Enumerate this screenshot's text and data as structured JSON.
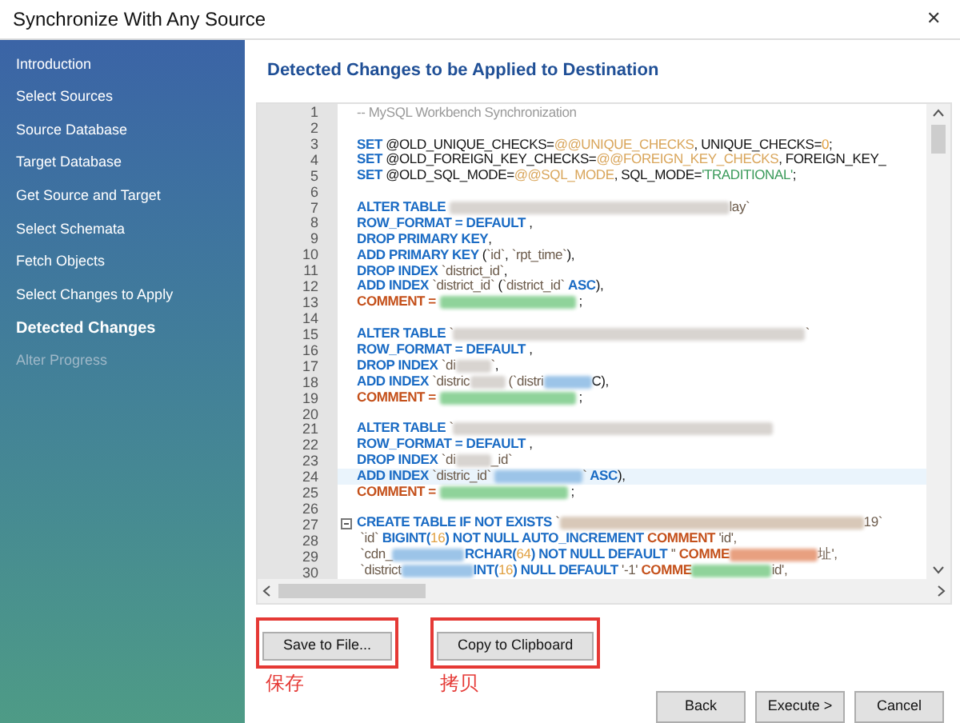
{
  "window": {
    "title": "Synchronize With Any Source",
    "close": "✕"
  },
  "sidebar": {
    "items": [
      {
        "label": "Introduction",
        "selected": false,
        "disabled": false
      },
      {
        "label": "Select Sources",
        "selected": false,
        "disabled": false
      },
      {
        "label": "Source Database",
        "selected": false,
        "disabled": false
      },
      {
        "label": "Target Database",
        "selected": false,
        "disabled": false
      },
      {
        "label": "Get Source and Target",
        "selected": false,
        "disabled": false
      },
      {
        "label": "Select Schemata",
        "selected": false,
        "disabled": false
      },
      {
        "label": "Fetch Objects",
        "selected": false,
        "disabled": false
      },
      {
        "label": "Select Changes to Apply",
        "selected": false,
        "disabled": false
      },
      {
        "label": "Detected Changes",
        "selected": true,
        "disabled": false
      },
      {
        "label": "Alter Progress",
        "selected": false,
        "disabled": true
      }
    ]
  },
  "heading": "Detected Changes to be Applied to Destination",
  "editor": {
    "lines": [
      {
        "n": "1",
        "current": false,
        "fold": false,
        "segs": [
          {
            "kind": "comment",
            "text": "-- MySQL Workbench Synchronization"
          }
        ]
      },
      {
        "n": "2",
        "current": false,
        "fold": false
      },
      {
        "n": "3",
        "current": false,
        "fold": false,
        "segs": [
          {
            "kind": "kw",
            "text": "SET "
          },
          {
            "kind": "plain",
            "text": "@OLD_UNIQUE_CHECKS="
          },
          {
            "kind": "sys",
            "text": "@@UNIQUE_CHECKS"
          },
          {
            "kind": "plain",
            "text": ", UNIQUE_CHECKS="
          },
          {
            "kind": "num",
            "text": "0"
          },
          {
            "kind": "plain",
            "text": ";"
          }
        ]
      },
      {
        "n": "4",
        "current": false,
        "fold": false,
        "segs": [
          {
            "kind": "kw",
            "text": "SET "
          },
          {
            "kind": "plain",
            "text": "@OLD_FOREIGN_KEY_CHECKS="
          },
          {
            "kind": "sys",
            "text": "@@FOREIGN_KEY_CHECKS"
          },
          {
            "kind": "plain",
            "text": ", FOREIGN_KEY_"
          }
        ]
      },
      {
        "n": "5",
        "current": false,
        "fold": false,
        "segs": [
          {
            "kind": "kw",
            "text": "SET "
          },
          {
            "kind": "plain",
            "text": "@OLD_SQL_MODE="
          },
          {
            "kind": "sys",
            "text": "@@SQL_MODE"
          },
          {
            "kind": "plain",
            "text": ", SQL_MODE="
          },
          {
            "kind": "green",
            "text": "'TRADITIONAL'"
          },
          {
            "kind": "plain",
            "text": ";"
          }
        ]
      },
      {
        "n": "6",
        "current": false,
        "fold": false
      },
      {
        "n": "7",
        "current": false,
        "fold": false,
        "segs": [
          {
            "kind": "kw",
            "text": "ALTER TABLE "
          },
          {
            "kind": "blur",
            "color": "#d8d4d0"
          },
          {
            "kind": "str",
            "text": "lay`"
          }
        ]
      },
      {
        "n": "8",
        "current": false,
        "fold": false,
        "segs": [
          {
            "kind": "kw",
            "text": "ROW_FORMAT = DEFAULT"
          },
          {
            "kind": "plain",
            "text": " ,"
          }
        ]
      },
      {
        "n": "9",
        "current": false,
        "fold": false,
        "segs": [
          {
            "kind": "kw",
            "text": "DROP PRIMARY KEY"
          },
          {
            "kind": "plain",
            "text": ","
          }
        ]
      },
      {
        "n": "10",
        "current": false,
        "fold": false,
        "segs": [
          {
            "kind": "kw",
            "text": "ADD PRIMARY KEY "
          },
          {
            "kind": "plain",
            "text": "("
          },
          {
            "kind": "str",
            "text": "`id`"
          },
          {
            "kind": "plain",
            "text": ", "
          },
          {
            "kind": "str",
            "text": "`rpt_time`"
          },
          {
            "kind": "plain",
            "text": "),"
          }
        ]
      },
      {
        "n": "11",
        "current": false,
        "fold": false,
        "segs": [
          {
            "kind": "kw",
            "text": "DROP INDEX "
          },
          {
            "kind": "str",
            "text": "`district_id`"
          },
          {
            "kind": "plain",
            "text": ","
          }
        ]
      },
      {
        "n": "12",
        "current": false,
        "fold": false,
        "segs": [
          {
            "kind": "kw",
            "text": "ADD INDEX "
          },
          {
            "kind": "str",
            "text": "`district_id` "
          },
          {
            "kind": "plain",
            "text": "("
          },
          {
            "kind": "str",
            "text": "`district_id` "
          },
          {
            "kind": "kw",
            "text": "ASC"
          },
          {
            "kind": "plain",
            "text": "),"
          }
        ]
      },
      {
        "n": "13",
        "current": false,
        "fold": false,
        "segs": [
          {
            "kind": "kw2",
            "text": "COMMENT = "
          },
          {
            "kind": "blur",
            "color": "#8fd39a"
          },
          {
            "kind": "plain",
            "text": " ;"
          }
        ]
      },
      {
        "n": "14",
        "current": false,
        "fold": false
      },
      {
        "n": "15",
        "current": false,
        "fold": false,
        "segs": [
          {
            "kind": "kw",
            "text": "ALTER TABLE "
          },
          {
            "kind": "str",
            "text": "`"
          },
          {
            "kind": "blur",
            "color": "#d8d4d0"
          },
          {
            "kind": "str",
            "text": "`"
          }
        ]
      },
      {
        "n": "16",
        "current": false,
        "fold": false,
        "segs": [
          {
            "kind": "kw",
            "text": "ROW_FORMAT = DEFAULT"
          },
          {
            "kind": "plain",
            "text": " ,"
          }
        ]
      },
      {
        "n": "17",
        "current": false,
        "fold": false,
        "segs": [
          {
            "kind": "kw",
            "text": "DROP INDEX "
          },
          {
            "kind": "str",
            "text": "`di"
          },
          {
            "kind": "blur",
            "color": "#d8d4d0"
          },
          {
            "kind": "str",
            "text": "`"
          },
          {
            "kind": "plain",
            "text": ","
          }
        ]
      },
      {
        "n": "18",
        "current": false,
        "fold": false,
        "segs": [
          {
            "kind": "kw",
            "text": "ADD INDEX "
          },
          {
            "kind": "str",
            "text": "`distric"
          },
          {
            "kind": "blur",
            "color": "#d8d4d0"
          },
          {
            "kind": "str",
            "text": " (`distri"
          },
          {
            "kind": "blur",
            "color": "#9cc4e8"
          },
          {
            "kind": "plain",
            "text": "C),"
          }
        ]
      },
      {
        "n": "19",
        "current": false,
        "fold": false,
        "segs": [
          {
            "kind": "kw2",
            "text": "COMMENT = "
          },
          {
            "kind": "blur",
            "color": "#8fd39a"
          },
          {
            "kind": "plain",
            "text": " ;"
          }
        ]
      },
      {
        "n": "20",
        "current": false,
        "fold": false
      },
      {
        "n": "21",
        "current": false,
        "fold": false,
        "segs": [
          {
            "kind": "kw",
            "text": "ALTER TABLE "
          },
          {
            "kind": "str",
            "text": "`"
          },
          {
            "kind": "blur",
            "color": "#d8d4d0"
          }
        ]
      },
      {
        "n": "22",
        "current": false,
        "fold": false,
        "segs": [
          {
            "kind": "kw",
            "text": "ROW_FORMAT = DEFAULT"
          },
          {
            "kind": "plain",
            "text": " ,"
          }
        ]
      },
      {
        "n": "23",
        "current": false,
        "fold": false,
        "segs": [
          {
            "kind": "kw",
            "text": "DROP INDEX "
          },
          {
            "kind": "str",
            "text": "`di"
          },
          {
            "kind": "blur",
            "color": "#d8d4d0"
          },
          {
            "kind": "str",
            "text": "_id`"
          }
        ]
      },
      {
        "n": "24",
        "current": true,
        "fold": false,
        "segs": [
          {
            "kind": "kw",
            "text": "ADD INDEX "
          },
          {
            "kind": "str",
            "text": "`distric_id` "
          },
          {
            "kind": "blur",
            "color": "#9cc4e8"
          },
          {
            "kind": "str",
            "text": "`"
          },
          {
            "kind": "kw",
            "text": " ASC"
          },
          {
            "kind": "plain",
            "text": "),"
          }
        ]
      },
      {
        "n": "25",
        "current": false,
        "fold": false,
        "segs": [
          {
            "kind": "kw2",
            "text": "COMMENT = "
          },
          {
            "kind": "blur",
            "color": "#8fd39a"
          },
          {
            "kind": "plain",
            "text": " ;"
          }
        ]
      },
      {
        "n": "26",
        "current": false,
        "fold": false
      },
      {
        "n": "27",
        "current": false,
        "fold": true,
        "segs": [
          {
            "kind": "kw",
            "text": "CREATE TABLE IF NOT EXISTS "
          },
          {
            "kind": "str",
            "text": "`"
          },
          {
            "kind": "blur",
            "color": "#d8c8b8"
          },
          {
            "kind": "str",
            "text": "19`"
          }
        ]
      },
      {
        "n": "28",
        "current": false,
        "fold": false,
        "segs": [
          {
            "kind": "str",
            "text": " `id` "
          },
          {
            "kind": "kw",
            "text": "BIGINT("
          },
          {
            "kind": "num",
            "text": "16"
          },
          {
            "kind": "kw",
            "text": ") NOT NULL AUTO_INCREMENT "
          },
          {
            "kind": "kw2",
            "text": "COMMENT "
          },
          {
            "kind": "str",
            "text": "'id',"
          }
        ]
      },
      {
        "n": "29",
        "current": false,
        "fold": false,
        "segs": [
          {
            "kind": "str",
            "text": " `cdn_"
          },
          {
            "kind": "blur",
            "color": "#9cc4e8"
          },
          {
            "kind": "kw",
            "text": "RCHAR("
          },
          {
            "kind": "num",
            "text": "64"
          },
          {
            "kind": "kw",
            "text": ") NOT NULL DEFAULT "
          },
          {
            "kind": "str",
            "text": "'' "
          },
          {
            "kind": "kw2",
            "text": "COMME"
          },
          {
            "kind": "blur",
            "color": "#e8a080"
          },
          {
            "kind": "str",
            "text": "址',"
          }
        ]
      },
      {
        "n": "30",
        "current": false,
        "fold": false,
        "segs": [
          {
            "kind": "str",
            "text": " `district"
          },
          {
            "kind": "blur",
            "color": "#9cc4e8"
          },
          {
            "kind": "kw",
            "text": "INT("
          },
          {
            "kind": "num",
            "text": "16"
          },
          {
            "kind": "kw",
            "text": ") NULL DEFAULT "
          },
          {
            "kind": "str",
            "text": "'-1' "
          },
          {
            "kind": "kw2",
            "text": "COMME"
          },
          {
            "kind": "blur",
            "color": "#8fd39a"
          },
          {
            "kind": "str",
            "text": "id',"
          }
        ]
      }
    ]
  },
  "actions": [
    {
      "label": "Save to File...",
      "highlighted": true,
      "note": "保存"
    },
    {
      "label": "Copy to Clipboard",
      "highlighted": true,
      "note": "拷贝"
    }
  ],
  "nav_buttons": [
    "Back",
    "Execute >",
    "Cancel"
  ]
}
